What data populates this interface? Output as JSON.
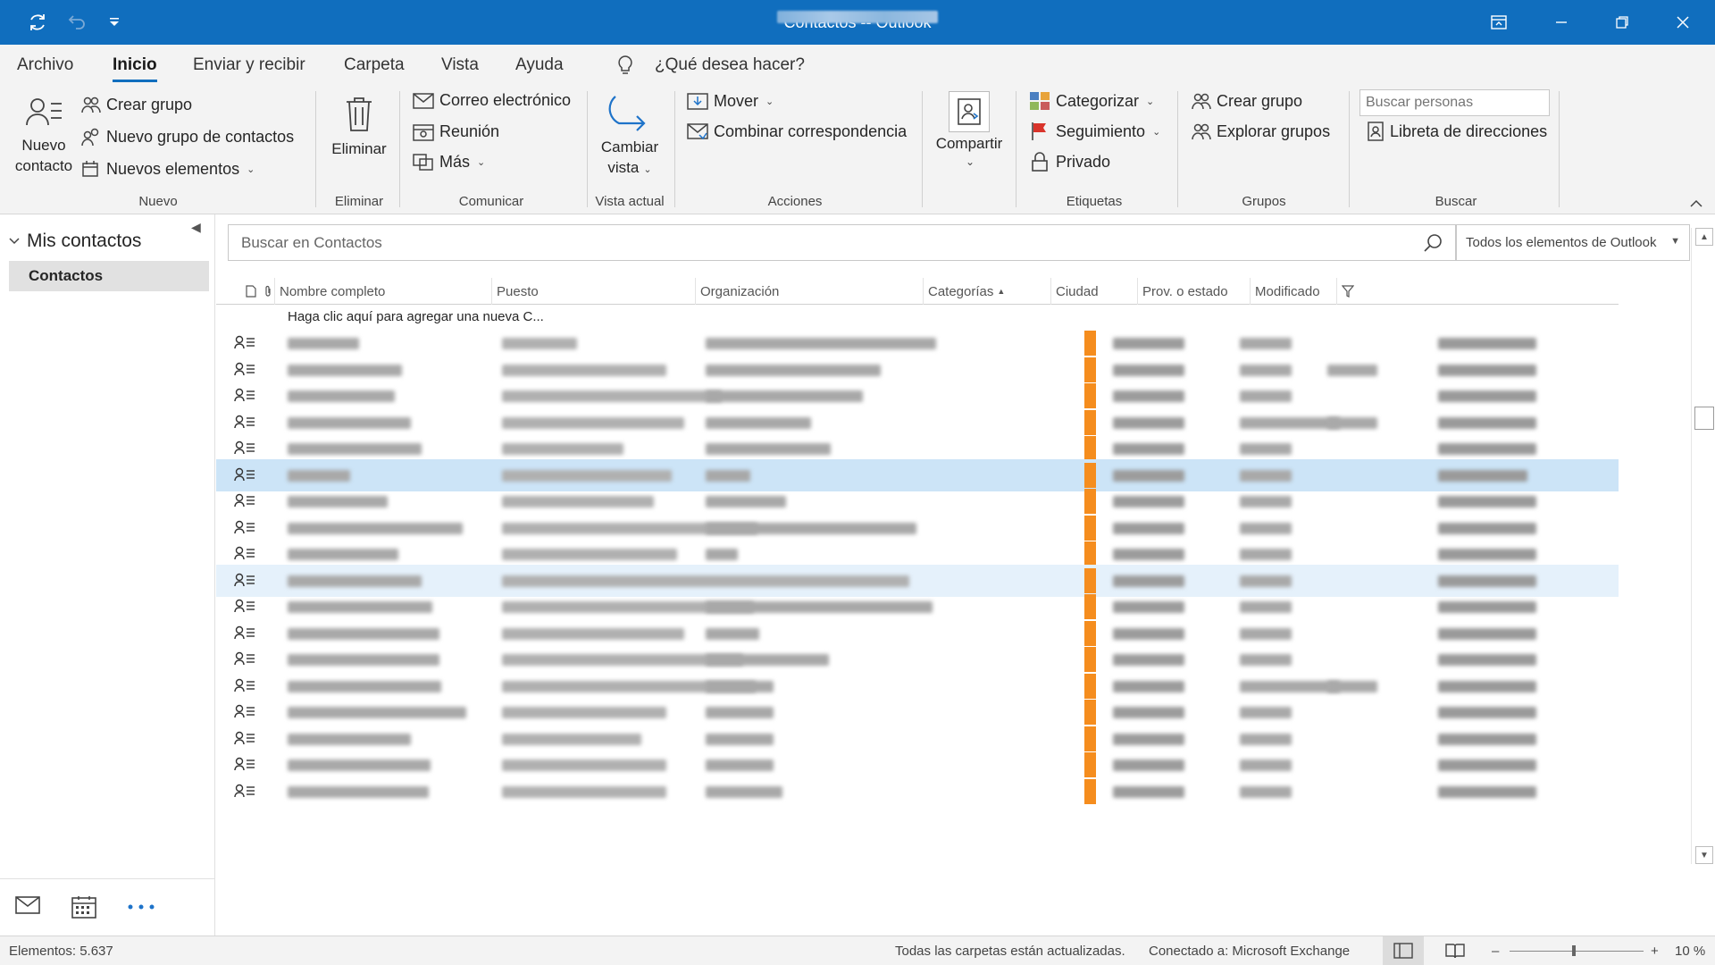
{
  "titlebar": {
    "title_prefix": "Contactos -",
    "title_suffix": "- Outlook",
    "bg_color": "#106ebe"
  },
  "menu": {
    "tabs": [
      {
        "label": "Archivo",
        "active": false
      },
      {
        "label": "Inicio",
        "active": true
      },
      {
        "label": "Enviar y recibir",
        "active": false
      },
      {
        "label": "Carpeta",
        "active": false
      },
      {
        "label": "Vista",
        "active": false
      },
      {
        "label": "Ayuda",
        "active": false
      }
    ],
    "tell_me": "¿Qué desea hacer?"
  },
  "ribbon": {
    "nuevo": {
      "new_contact_line1": "Nuevo",
      "new_contact_line2": "contacto",
      "create_group": "Crear grupo",
      "new_contact_group": "Nuevo grupo de contactos",
      "new_items": "Nuevos elementos",
      "group_label": "Nuevo"
    },
    "eliminar": {
      "delete": "Eliminar",
      "group_label": "Eliminar"
    },
    "comunicar": {
      "email": "Correo electrónico",
      "meeting": "Reunión",
      "more": "Más",
      "group_label": "Comunicar"
    },
    "vista_actual": {
      "change_line1": "Cambiar",
      "change_line2": "vista",
      "group_label": "Vista actual"
    },
    "acciones": {
      "move": "Mover",
      "mail_merge": "Combinar correspondencia",
      "group_label": "Acciones"
    },
    "compartir": {
      "share": "Compartir"
    },
    "etiquetas": {
      "categorize": "Categorizar",
      "follow_up": "Seguimiento",
      "private": "Privado",
      "group_label": "Etiquetas"
    },
    "grupos": {
      "create_group": "Crear grupo",
      "browse_groups": "Explorar grupos",
      "group_label": "Grupos"
    },
    "buscar": {
      "search_people_placeholder": "Buscar personas",
      "address_book": "Libreta de direcciones",
      "group_label": "Buscar"
    }
  },
  "leftnav": {
    "section": "Mis contactos",
    "selected_item": "Contactos"
  },
  "main": {
    "search_placeholder": "Buscar en Contactos",
    "scope": "Todos los elementos de Outlook",
    "columns": [
      "Nombre completo",
      "Puesto",
      "Organización",
      "Categorías",
      "Ciudad",
      "Prov. o estado",
      "Modificado"
    ],
    "sorted_column": "Categorías",
    "new_row_hint": "Haga clic aquí para agregar una nueva C...",
    "category_color": "#f58d1e",
    "selected_row_index": 5,
    "hover_row_index": 9
  },
  "statusbar": {
    "items": "Elementos: 5.637",
    "sync": "Todas las carpetas están actualizadas.",
    "connection": "Conectado a: Microsoft Exchange",
    "zoom": "10 %"
  }
}
